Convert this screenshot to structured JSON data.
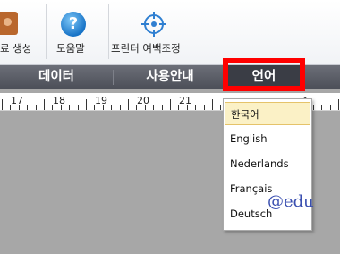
{
  "toolbar": {
    "items": [
      {
        "label": "료 생성",
        "icon": "address-book-icon"
      },
      {
        "label": "도움말",
        "icon": "help-icon"
      },
      {
        "label": "프린터 여백조정",
        "icon": "crosshair-target-icon"
      }
    ]
  },
  "menubar": {
    "items": [
      {
        "label": "데이터"
      },
      {
        "label": "사용안내"
      },
      {
        "label": "언어",
        "active": true
      }
    ]
  },
  "ruler": {
    "labels": [
      "17",
      "18",
      "19",
      "20",
      "21",
      "4"
    ]
  },
  "language_menu": {
    "options": [
      "한국어",
      "English",
      "Nederlands",
      "Français",
      "Deutsch"
    ],
    "selected": "한국어"
  },
  "watermark": "@edu",
  "colors": {
    "highlight": "#ff0000",
    "menubar": "#55585f",
    "selected_item": "#fbf1c6",
    "workspace": "#a7a7a7"
  }
}
